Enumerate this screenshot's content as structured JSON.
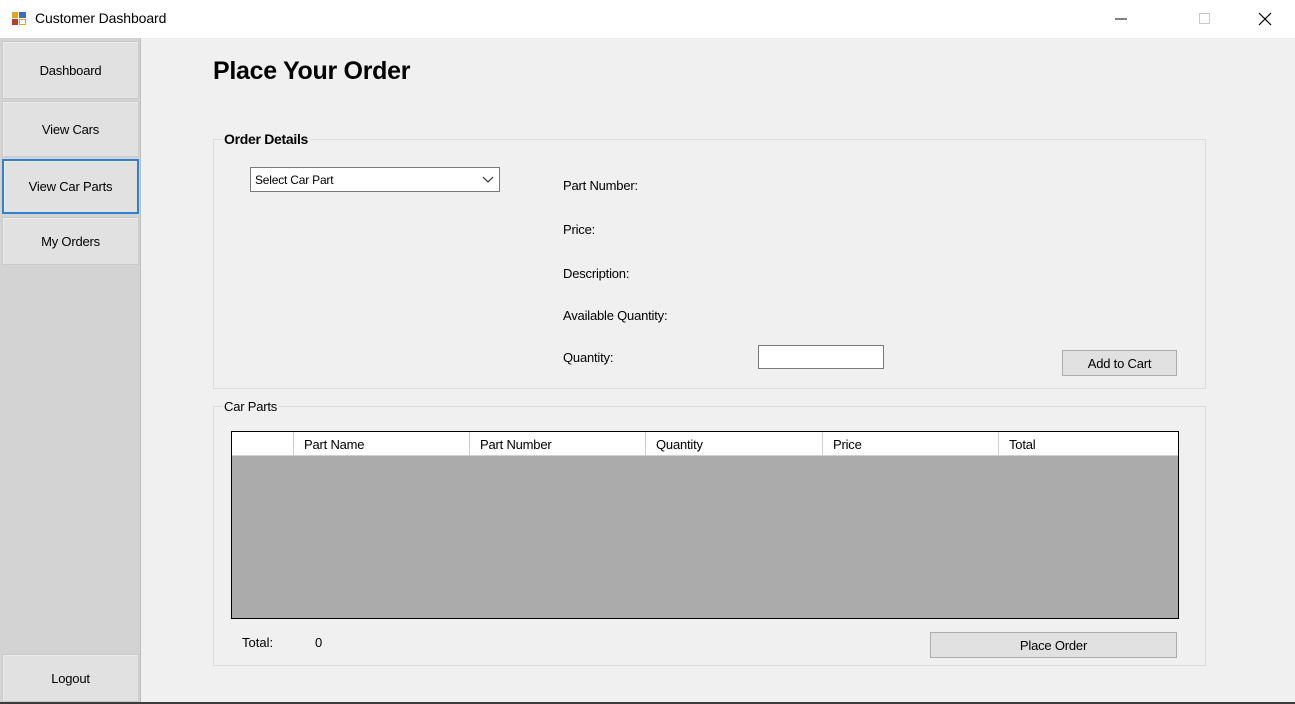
{
  "window": {
    "title": "Customer Dashboard"
  },
  "sidebar": {
    "items": [
      {
        "label": "Dashboard"
      },
      {
        "label": "View Cars"
      },
      {
        "label": "View Car Parts"
      },
      {
        "label": "My Orders"
      }
    ],
    "logout_label": "Logout"
  },
  "main": {
    "title": "Place Your Order",
    "order_details": {
      "legend": "Order Details",
      "select_value": "Select Car Part",
      "labels": {
        "part_number": "Part Number:",
        "price": "Price:",
        "description": "Description:",
        "available_quantity": "Available Quantity:",
        "quantity": "Quantity:"
      },
      "quantity_value": "",
      "add_to_cart_label": "Add to Cart"
    },
    "car_parts": {
      "legend": "Car Parts",
      "columns": [
        "",
        "Part Name",
        "Part Number",
        "Quantity",
        "Price",
        "Total"
      ],
      "rows": [],
      "total_label": "Total:",
      "total_value": "0",
      "place_order_label": "Place Order"
    }
  },
  "colors": {
    "focus_border": "#2f7fd4",
    "grid_background": "#ababab",
    "sidebar_background": "#d3d3d3"
  }
}
